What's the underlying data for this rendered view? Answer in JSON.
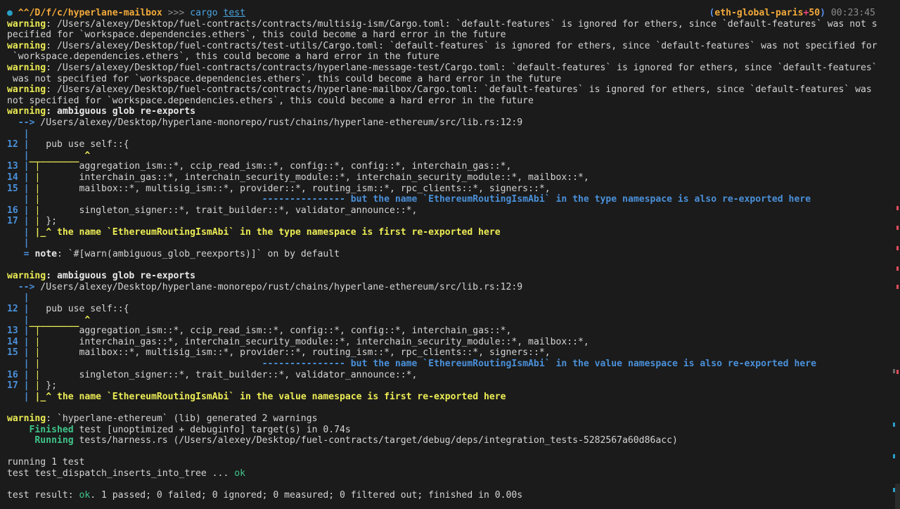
{
  "prompt": {
    "status_dot": "●",
    "path_prefix": "^^/D/f/c/",
    "dir": "hyperlane-mailbox",
    "arrows": ">>>",
    "command": "cargo",
    "command_arg": "test",
    "branch_open": "(",
    "branch": "eth-global-paris",
    "plus": "+",
    "ahead": "50",
    "branch_close": ")",
    "time": "00:23:45"
  },
  "warn_label": "warning",
  "cargo_warnings": [
    {
      "l1": ": /Users/alexey/Desktop/fuel-contracts/contracts/multisig-ism/Cargo.toml: `default-features` is ignored for ethers, since `default-features` was not s",
      "l2": "pecified for `workspace.dependencies.ethers`, this could become a hard error in the future"
    },
    {
      "l1": ": /Users/alexey/Desktop/fuel-contracts/test-utils/Cargo.toml: `default-features` is ignored for ethers, since `default-features` was not specified for",
      "l2": " `workspace.dependencies.ethers`, this could become a hard error in the future"
    },
    {
      "l1": ": /Users/alexey/Desktop/fuel-contracts/contracts/hyperlane-message-test/Cargo.toml: `default-features` is ignored for ethers, since `default-features`",
      "l2": " was not specified for `workspace.dependencies.ethers`, this could become a hard error in the future"
    },
    {
      "l1": ": /Users/alexey/Desktop/fuel-contracts/contracts/hyperlane-mailbox/Cargo.toml: `default-features` is ignored for ethers, since `default-features` was",
      "l2": "not specified for `workspace.dependencies.ethers`, this could become a hard error in the future"
    }
  ],
  "diagnostics": [
    {
      "title": ": ambiguous glob re-exports",
      "arrow": "  -->",
      "location": " /Users/alexey/Desktop/hyperlane-monorepo/rust/chains/hyperlane-ethereum/src/lib.rs:12:9",
      "code": [
        {
          "num": "12",
          "text": "   pub use self::{"
        },
        {
          "num": "13",
          "text": "       aggregation_ism::*, ccip_read_ism::*, config::*, config::*, interchain_gas::*,"
        },
        {
          "num": "14",
          "text": "       interchain_gas::*, interchain_security_module::*, interchain_security_module::*, mailbox::*,"
        },
        {
          "num": "15",
          "text": "       mailbox::*, multisig_ism::*, provider::*, routing_ism::*, rpc_clients::*, signers::*,"
        },
        {
          "num": "16",
          "text": "       singleton_signer::*, trait_builder::*, validator_announce::*,"
        },
        {
          "num": "17",
          "text": " };"
        }
      ],
      "caret_line": "          ^",
      "underscore_line": "_________",
      "secondary_dashes": "               ",
      "secondary_msg": " but the name `EthereumRoutingIsmAbi` in the type namespace is also re-exported here",
      "primary_msg": " the name `EthereumRoutingIsmAbi` in the type namespace is first re-exported here",
      "note_label": "note",
      "note_text": ": `#[warn(ambiguous_glob_reexports)]` on by default"
    },
    {
      "title": ": ambiguous glob re-exports",
      "arrow": "  -->",
      "location": " /Users/alexey/Desktop/hyperlane-monorepo/rust/chains/hyperlane-ethereum/src/lib.rs:12:9",
      "code": [
        {
          "num": "12",
          "text": "   pub use self::{"
        },
        {
          "num": "13",
          "text": "       aggregation_ism::*, ccip_read_ism::*, config::*, config::*, interchain_gas::*,"
        },
        {
          "num": "14",
          "text": "       interchain_gas::*, interchain_security_module::*, interchain_security_module::*, mailbox::*,"
        },
        {
          "num": "15",
          "text": "       mailbox::*, multisig_ism::*, provider::*, routing_ism::*, rpc_clients::*, signers::*,"
        },
        {
          "num": "16",
          "text": "       singleton_signer::*, trait_builder::*, validator_announce::*,"
        },
        {
          "num": "17",
          "text": " };"
        }
      ],
      "caret_line": "          ^",
      "underscore_line": "_________",
      "secondary_dashes": "               ",
      "secondary_msg": " but the name `EthereumRoutingIsmAbi` in the value namespace is also re-exported here",
      "primary_msg": " the name `EthereumRoutingIsmAbi` in the value namespace is first re-exported here"
    }
  ],
  "summary": {
    "generated": ": `hyperlane-ethereum` (lib) generated 2 warnings",
    "finished_label": "    Finished",
    "finished_text": " test [unoptimized + debuginfo] target(s) in 0.74s",
    "running_label": "     Running",
    "running_text": " tests/harness.rs (/Users/alexey/Desktop/fuel-contracts/target/debug/deps/integration_tests-5282567a60d86acc)",
    "running_tests": "running 1 test",
    "test_line": "test test_dispatch_inserts_into_tree ... ",
    "test_status": "ok",
    "result_prefix": "test result: ",
    "result_status": "ok",
    "result_text": ". 1 passed; 0 failed; 0 ignored; 0 measured; 0 filtered out; finished in 0.00s"
  }
}
